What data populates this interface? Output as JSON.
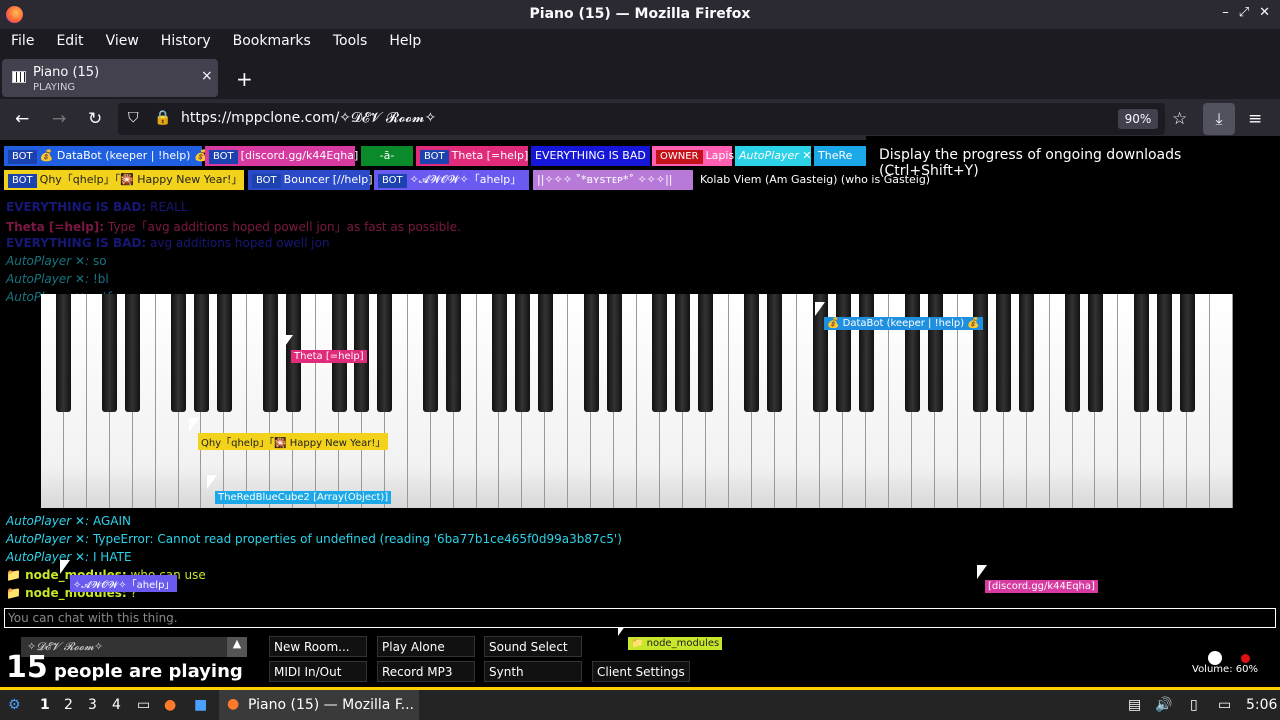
{
  "window": {
    "title": "Piano (15) — Mozilla Firefox"
  },
  "menu": [
    "File",
    "Edit",
    "View",
    "History",
    "Bookmarks",
    "Tools",
    "Help"
  ],
  "tab": {
    "title": "Piano (15)",
    "subtitle": "PLAYING",
    "close": "×"
  },
  "newtab": "+",
  "nav": {
    "url": "https://mppclone.com/✧𝓓𝓔𝓥 𝓡𝓸𝓸𝓶✧",
    "zoom": "90%"
  },
  "tooltip": "Display the progress of ongoing downloads (Ctrl+Shift+Y)",
  "users": [
    {
      "bot": "BOT",
      "name": "💰 DataBot (keeper | !help) 💰",
      "color": "#1f5fe0"
    },
    {
      "bot": "BOT",
      "name": "[discord.gg/k44Eqha]",
      "color": "#d73aa0"
    },
    {
      "bot": "",
      "name": "-ā-",
      "color": "#0a8a2a"
    },
    {
      "bot": "BOT",
      "name": "Theta [=help]",
      "color": "#e02a7a"
    },
    {
      "bot": "",
      "name": "EVERYTHING IS BAD",
      "color": "#1616d8"
    },
    {
      "bot": "OWNER",
      "name": "Lapis",
      "color": "#ff5fb0"
    },
    {
      "bot": "",
      "name": "AutoPlayer ✕",
      "color": "#2bd2e8"
    },
    {
      "bot": "",
      "name": "TheRe",
      "color": "#1aa8e8"
    },
    {
      "bot": "BOT",
      "name": "Qhy「qhelp」「🎇 Happy New Year!」",
      "color": "#f2d21a"
    },
    {
      "bot": "BOT",
      "name": "Bouncer [//help]",
      "color": "#2a4ac8"
    },
    {
      "bot": "BOT",
      "name": "✧𝓐𝓦𝓞𝓦✧「ahelp」",
      "color": "#6a5af0"
    },
    {
      "bot": "",
      "name": "||✧✧✧ ˚*ʙʏsᴛᴇᴘ*˚ ✧✧✧||",
      "color": "#b87ad8"
    },
    {
      "bot": "",
      "name": "Kolab Viem (Am Gasteig) (who is Gasteig)",
      "color": "#000000"
    }
  ],
  "chat": [
    {
      "name": "EVERYTHING IS BAD:",
      "text": "REALL",
      "color": "#2a2ad8"
    },
    {
      "name": "Theta [=help]:",
      "text": "Type「avg additions hoped powell jon」as fast as possible.",
      "color": "#e02a7a"
    },
    {
      "name": "EVERYTHING IS BAD:",
      "text": "avg additions hoped owell jon",
      "color": "#2a2ad8"
    },
    {
      "name": "AutoPlayer ✕:",
      "text": "so",
      "color": "#2bd2e8"
    },
    {
      "name": "AutoPlayer ✕:",
      "text": "!bl",
      "color": "#2bd2e8"
    },
    {
      "name": "AutoPlayer ✕:",
      "text": "wtf",
      "color": "#2bd2e8"
    }
  ],
  "chat_bottom": [
    {
      "name": "AutoPlayer ✕:",
      "text": "AGAIN",
      "color": "#2bd2e8"
    },
    {
      "name": "AutoPlayer ✕:",
      "text": "TypeError: Cannot read properties of undefined (reading '6ba77b1ce465f0d99a3b87c5')",
      "color": "#2bd2e8"
    },
    {
      "name": "AutoPlayer ✕:",
      "text": "I HATE",
      "color": "#2bd2e8"
    },
    {
      "name": "📁 node_modules:",
      "text": "who can use",
      "color": "#c8e62a"
    },
    {
      "name": "📁 node_modules:",
      "text": "?",
      "color": "#c8e62a"
    }
  ],
  "cursors": {
    "theta": "Theta [=help]",
    "databot": "💰 DataBot (keeper | !help) 💰",
    "qhy": "Qhy「qhelp」「🎇 Happy New Year!」",
    "redblue": "TheRedBlueCube2 [Array(Object)]",
    "awow": "✧𝓐𝓦𝓞𝓦✧「ahelp」",
    "discord": "[discord.gg/k44Eqha]",
    "node": "📁 node_modules"
  },
  "chat_input_placeholder": "You can chat with this thing.",
  "room": "✧𝓓𝓔𝓥 𝓡𝓸𝓸𝓶✧",
  "playing": {
    "count": "15",
    "label": "people are playing"
  },
  "buttons": {
    "new_room": "New Room...",
    "play_alone": "Play Alone",
    "sound_select": "Sound Select",
    "midi": "MIDI In/Out",
    "record": "Record MP3",
    "synth": "Synth",
    "client_settings": "Client Settings"
  },
  "volume": "Volume: 60%",
  "taskbar": {
    "workspaces": [
      "1",
      "2",
      "3",
      "4"
    ],
    "window": "Piano (15) — Mozilla F...",
    "clock": "5:06"
  }
}
